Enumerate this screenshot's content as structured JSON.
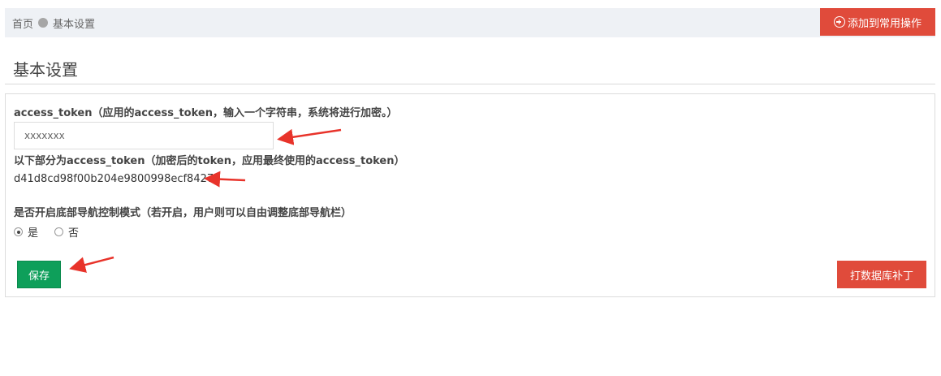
{
  "breadcrumb": {
    "home": "首页",
    "current": "基本设置"
  },
  "header": {
    "add_button_label": "添加到常用操作"
  },
  "page": {
    "title": "基本设置"
  },
  "form": {
    "access_token_label": "access_token（应用的access_token，输入一个字符串，系统将进行加密。）",
    "access_token_value": "xxxxxxx",
    "encrypted_label": "以下部分为access_token（加密后的token，应用最终使用的access_token）",
    "encrypted_value": "d41d8cd98f00b204e9800998ecf8427e",
    "nav_mode_label": "是否开启底部导航控制模式（若开启，用户则可以自由调整底部导航栏）",
    "radio_yes": "是",
    "radio_no": "否",
    "radio_selected": "是"
  },
  "buttons": {
    "save": "保存",
    "patch": "打数据库补丁"
  },
  "colors": {
    "danger": "#e04b3b",
    "success": "#0e9f5a",
    "annotation_arrow": "#e8332a"
  }
}
